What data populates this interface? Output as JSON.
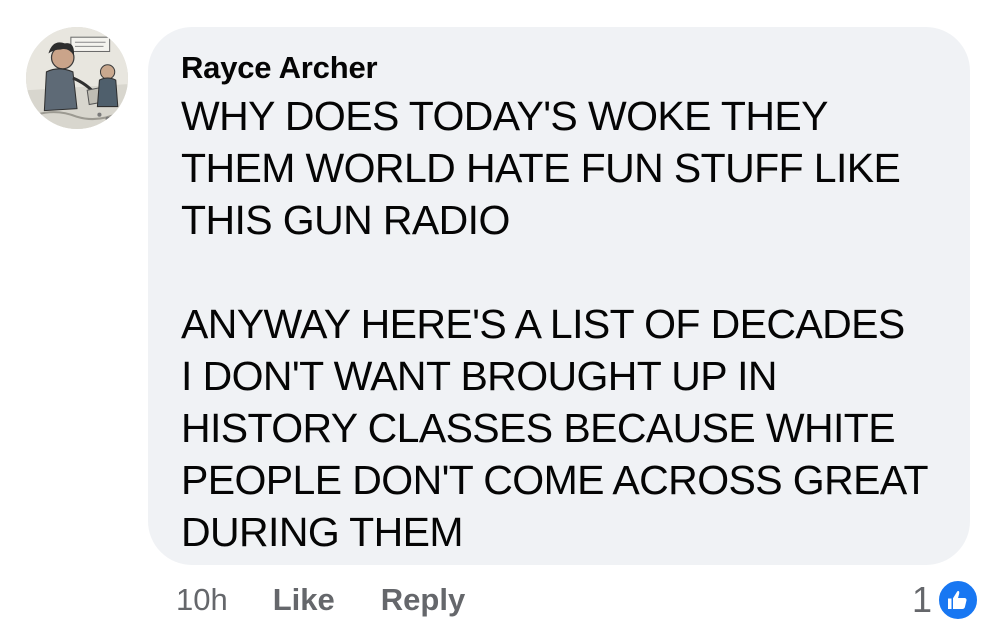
{
  "comment": {
    "author": "Rayce Archer",
    "avatar_icon": "profile-avatar-illustration",
    "paragraphs": [
      [
        "WHY DOES TODAY'S WOKE THEY",
        "THEM WORLD HATE FUN STUFF LIKE",
        "THIS GUN RADIO"
      ],
      [
        "ANYWAY HERE'S A LIST OF DECADES",
        "I DON'T WANT BROUGHT UP IN",
        "HISTORY CLASSES BECAUSE WHITE",
        "PEOPLE DON'T COME ACROSS GREAT",
        "DURING THEM"
      ]
    ]
  },
  "actions": {
    "timestamp": "10h",
    "like_label": "Like",
    "reply_label": "Reply"
  },
  "reactions": {
    "count": "1",
    "icon": "thumbs-up-icon",
    "badge_color": "#1877f2"
  },
  "colors": {
    "bubble": "#f0f2f5",
    "text": "#050505",
    "secondary_text": "#65676b"
  }
}
